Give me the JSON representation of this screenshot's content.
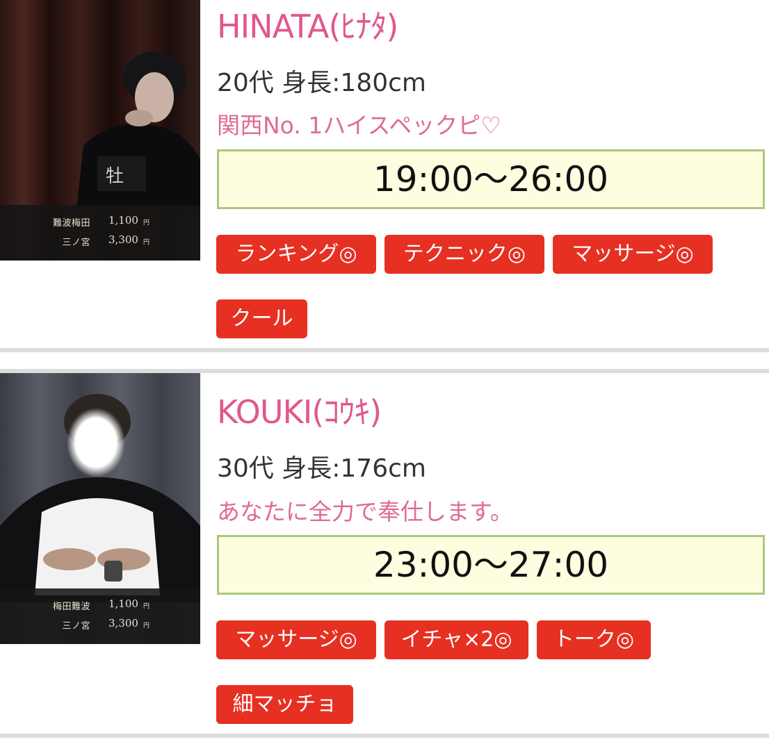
{
  "cast": [
    {
      "name": "HINATA(ﾋﾅﾀ)",
      "age_height": "20代 身長:180cm",
      "catchphrase": "関西No. 1ハイスペックピ♡",
      "hours": "19:00〜26:00",
      "prices": [
        {
          "area": "難波梅田",
          "amount": "1,100",
          "unit": "円"
        },
        {
          "area": "三ノ宮",
          "amount": "3,300",
          "unit": "円"
        }
      ],
      "tags": [
        "ランキング◎",
        "テクニック◎",
        "マッサージ◎",
        "クール"
      ]
    },
    {
      "name": "KOUKI(ｺｳｷ)",
      "age_height": "30代 身長:176cm",
      "catchphrase": "あなたに全力で奉仕します。",
      "hours": "23:00〜27:00",
      "prices": [
        {
          "area": "梅田難波",
          "amount": "1,100",
          "unit": "円"
        },
        {
          "area": "三ノ宮",
          "amount": "3,300",
          "unit": "円"
        }
      ],
      "tags": [
        "マッサージ◎",
        "イチャ×2◎",
        "トーク◎",
        "細マッチョ"
      ]
    }
  ],
  "colors": {
    "name": "#e0588d",
    "catch": "#df6b94",
    "tag_bg": "#e63022",
    "time_bg": "#fdfde0",
    "time_border": "#a9c97a"
  }
}
